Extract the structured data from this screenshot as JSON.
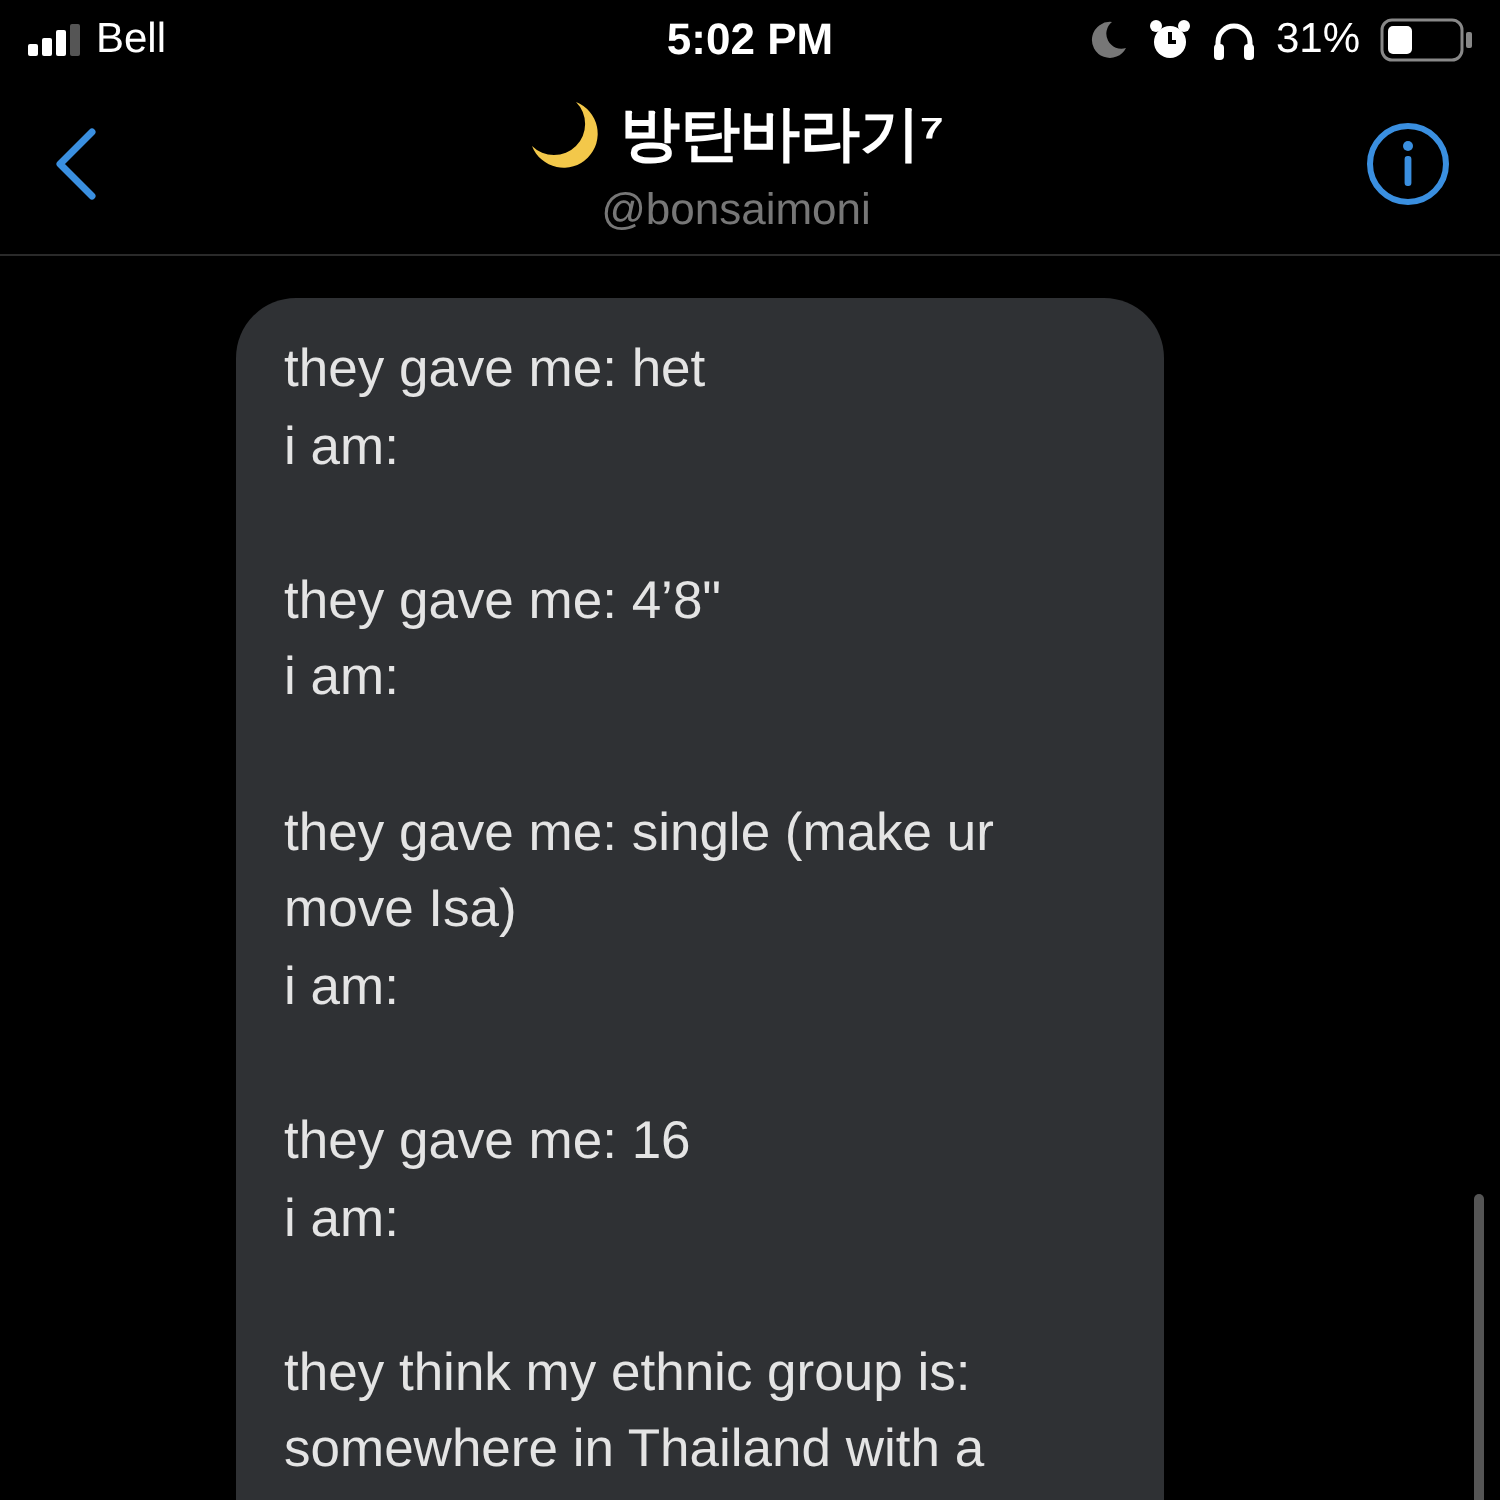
{
  "status_bar": {
    "carrier": "Bell",
    "time": "5:02 PM",
    "battery": "31%"
  },
  "header": {
    "title": "방탄바라기⁷",
    "handle": "@bonsaimoni"
  },
  "message": {
    "paragraphs": [
      [
        "they gave me: het",
        "i am:"
      ],
      [
        "they gave me: 4’8\"",
        "i am:"
      ],
      [
        "they gave me: single (make ur",
        "move Isa)",
        "i am:"
      ],
      [
        "they gave me: 16",
        "i am:"
      ],
      [
        "they think my ethnic group is:",
        "somewhere in Thailand with a"
      ]
    ]
  }
}
